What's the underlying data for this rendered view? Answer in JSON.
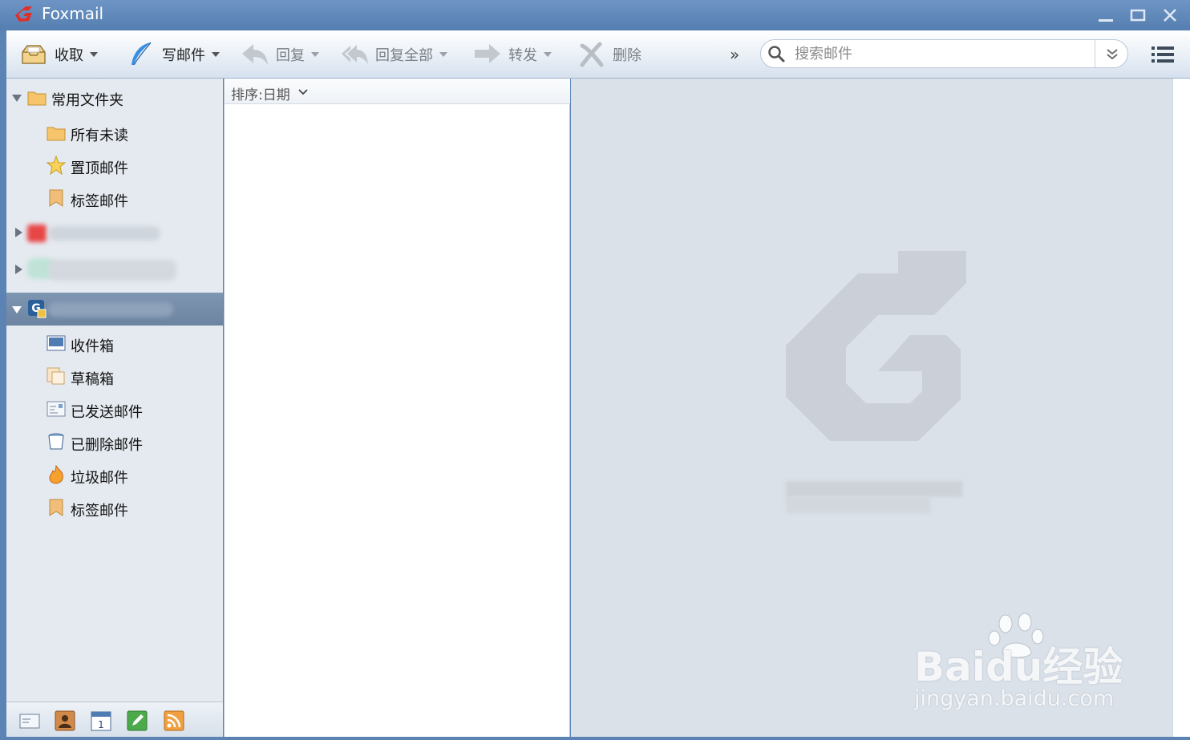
{
  "window": {
    "title": "Foxmail"
  },
  "toolbar": {
    "receive": "收取",
    "compose": "写邮件",
    "reply": "回复",
    "reply_all": "回复全部",
    "forward": "转发",
    "delete": "删除",
    "more": "»"
  },
  "search": {
    "placeholder": "搜索邮件"
  },
  "sidebar": {
    "common_folder": {
      "label": "常用文件夹",
      "items": [
        "所有未读",
        "置顶邮件",
        "标签邮件"
      ]
    },
    "account_folders": [
      "收件箱",
      "草稿箱",
      "已发送邮件",
      "已删除邮件",
      "垃圾邮件",
      "标签邮件"
    ]
  },
  "message_list": {
    "sort_label": "排序:日期"
  },
  "watermark": {
    "brand": "Baidu经验",
    "url": "jingyan.baidu.com"
  },
  "colors": {
    "titlebar": "#5b83b3",
    "sidebar": "#e5eaf0",
    "preview": "#dbe1e9",
    "selected_row": "#7790ad",
    "brand_red": "#e0302a"
  }
}
